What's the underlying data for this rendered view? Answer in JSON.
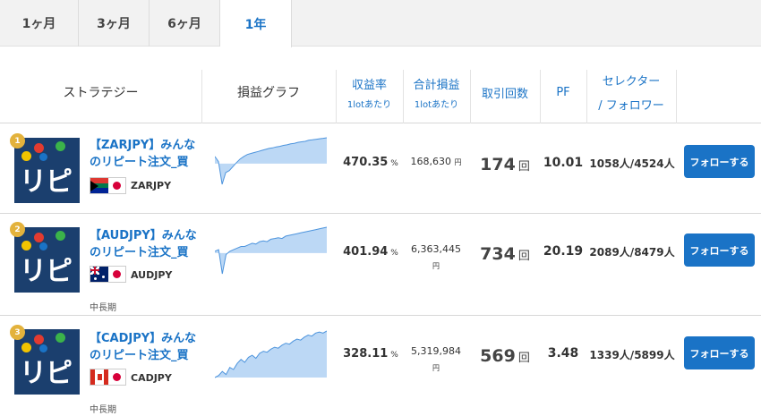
{
  "tabs": [
    {
      "label": "1ヶ月",
      "active": false
    },
    {
      "label": "3ヶ月",
      "active": false
    },
    {
      "label": "6ヶ月",
      "active": false
    },
    {
      "label": "1年",
      "active": true
    }
  ],
  "header": {
    "strategy": "ストラテジー",
    "graph": "損益グラフ",
    "return_rate": "収益率",
    "return_rate_sub": "1lotあたり",
    "total_pl": "合計損益",
    "total_pl_sub": "1lotあたり",
    "trade_count": "取引回数",
    "pf": "PF",
    "selector_1": "セレクター",
    "selector_2": "/ フォロワー"
  },
  "logo_text": "リピ",
  "colors": {
    "accent": "#1a73c6",
    "logo_bg": "#1b3f6e",
    "rank_badge": "#e3b23c",
    "chart_fill": "#bcd8f5",
    "chart_line": "#4d94dd"
  },
  "rows": [
    {
      "rank": "1",
      "name_line1": "【ZARJPY】みんな",
      "name_line2": "のリピート注文_買",
      "pair": "ZARJPY",
      "flag": "south-africa-japan-flag",
      "tag": "",
      "return_rate": "470.35",
      "return_unit": "%",
      "total_pl": "168,630",
      "pl_unit": "円",
      "trade_count": "174",
      "count_unit": "回",
      "pf": "10.01",
      "followers": "1058人/4524人",
      "button": "フォローする",
      "series": [
        0,
        -10,
        -55,
        -32,
        -28,
        -20,
        -12,
        -5,
        0,
        4,
        6,
        8,
        10,
        12,
        14,
        16,
        17,
        19,
        20,
        22,
        23,
        25,
        26,
        28,
        29,
        30,
        32,
        33,
        34,
        35,
        36,
        37
      ]
    },
    {
      "rank": "2",
      "name_line1": "【AUDJPY】みんな",
      "name_line2": "のリピート注文_買",
      "pair": "AUDJPY",
      "flag": "australia-japan-flag",
      "tag": "中長期",
      "return_rate": "401.94",
      "return_unit": "%",
      "total_pl": "6,363,445",
      "pl_unit": "円",
      "trade_count": "734",
      "count_unit": "回",
      "pf": "20.19",
      "followers": "2089人/8479人",
      "button": "フォローする",
      "series": [
        0,
        2,
        -28,
        -4,
        0,
        2,
        4,
        6,
        6,
        8,
        10,
        9,
        12,
        13,
        12,
        15,
        16,
        17,
        16,
        19,
        20,
        21,
        22,
        23,
        24,
        25,
        26,
        27,
        28,
        29,
        30
      ]
    },
    {
      "rank": "3",
      "name_line1": "【CADJPY】みんな",
      "name_line2": "のリピート注文_買",
      "pair": "CADJPY",
      "flag": "canada-japan-flag",
      "tag": "中長期",
      "return_rate": "328.11",
      "return_unit": "%",
      "total_pl": "5,319,984",
      "pl_unit": "円",
      "trade_count": "569",
      "count_unit": "回",
      "pf": "3.48",
      "followers": "1339人/5899人",
      "button": "フォローする",
      "series": [
        0,
        2,
        6,
        3,
        10,
        8,
        14,
        18,
        15,
        20,
        22,
        19,
        24,
        26,
        25,
        28,
        30,
        29,
        32,
        34,
        33,
        36,
        38,
        37,
        40,
        42,
        41,
        44,
        45,
        44,
        46
      ]
    }
  ]
}
